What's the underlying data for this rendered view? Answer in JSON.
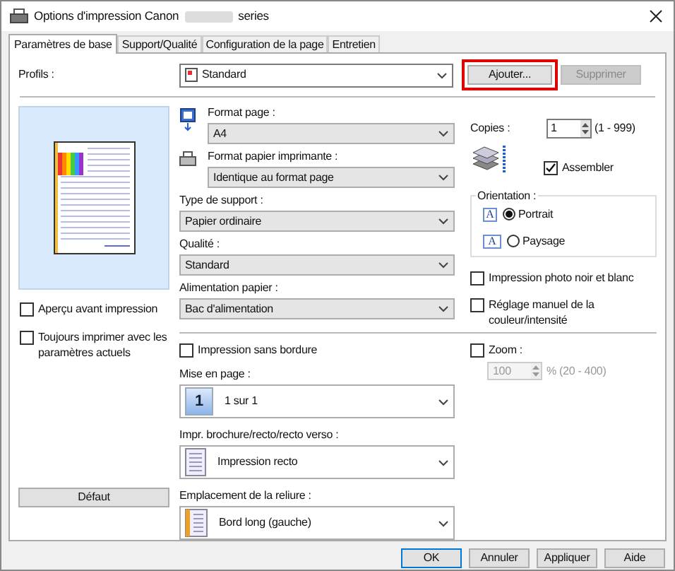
{
  "window": {
    "title_start": "Options d'impression Canon",
    "title_end": "series"
  },
  "tabs": [
    {
      "label": "Paramètres de base",
      "selected": true
    },
    {
      "label": "Support/Qualité",
      "selected": false
    },
    {
      "label": "Configuration de la page",
      "selected": false
    },
    {
      "label": "Entretien",
      "selected": false
    }
  ],
  "profiles": {
    "label": "Profils :",
    "value": "Standard",
    "add_button": {
      "label": "Ajouter...",
      "highlighted": true,
      "disabled": false
    },
    "delete_button": {
      "label": "Supprimer",
      "disabled": true
    }
  },
  "left": {
    "checkboxes": [
      {
        "label": "Aperçu avant impression",
        "checked": false
      },
      {
        "label": "Toujours imprimer avec les paramètres actuels",
        "checked": false
      }
    ],
    "default_button": "Défaut"
  },
  "fields": [
    {
      "label": "Format page :",
      "value": "A4",
      "kind": "page-size"
    },
    {
      "label": "Format papier imprimante :",
      "value": "Identique au format page",
      "kind": "printer-paper"
    },
    {
      "label": "Type de support :",
      "value": "Papier ordinaire"
    },
    {
      "label": "Qualité :",
      "value": "Standard"
    },
    {
      "label": "Alimentation papier :",
      "value": "Bac d'alimentation"
    }
  ],
  "copies": {
    "label": "Copies :",
    "value": "1",
    "range": "(1 - 999)",
    "collate": {
      "label": "Assembler",
      "checked": true
    }
  },
  "orientation": {
    "label": "Orientation :",
    "options": [
      {
        "label": "Portrait",
        "selected": true,
        "glyph": "A"
      },
      {
        "label": "Paysage",
        "selected": false,
        "glyph": "A"
      }
    ]
  },
  "right_checkboxes": [
    {
      "label": "Impression photo noir et blanc",
      "checked": false
    },
    {
      "label": "Réglage manuel de la couleur/intensité",
      "checked": false
    }
  ],
  "borderless": {
    "label": "Impression sans bordure",
    "checked": false
  },
  "layout_fields": [
    {
      "label": "Mise en page :",
      "value": "1 sur 1",
      "kind": "number",
      "icon_text": "1"
    },
    {
      "label": "Impr. brochure/recto/recto verso :",
      "value": "Impression recto",
      "kind": "page"
    },
    {
      "label": "Emplacement de la reliure :",
      "value": "Bord long (gauche)",
      "kind": "binding"
    }
  ],
  "zoom": {
    "label": "Zoom :",
    "checked": false,
    "value": "100",
    "range": "% (20 - 400)",
    "disabled": true
  },
  "buttons": [
    {
      "label": "OK",
      "default": true
    },
    {
      "label": "Annuler",
      "default": false
    },
    {
      "label": "Appliquer",
      "default": false
    },
    {
      "label": "Aide",
      "default": false
    }
  ]
}
